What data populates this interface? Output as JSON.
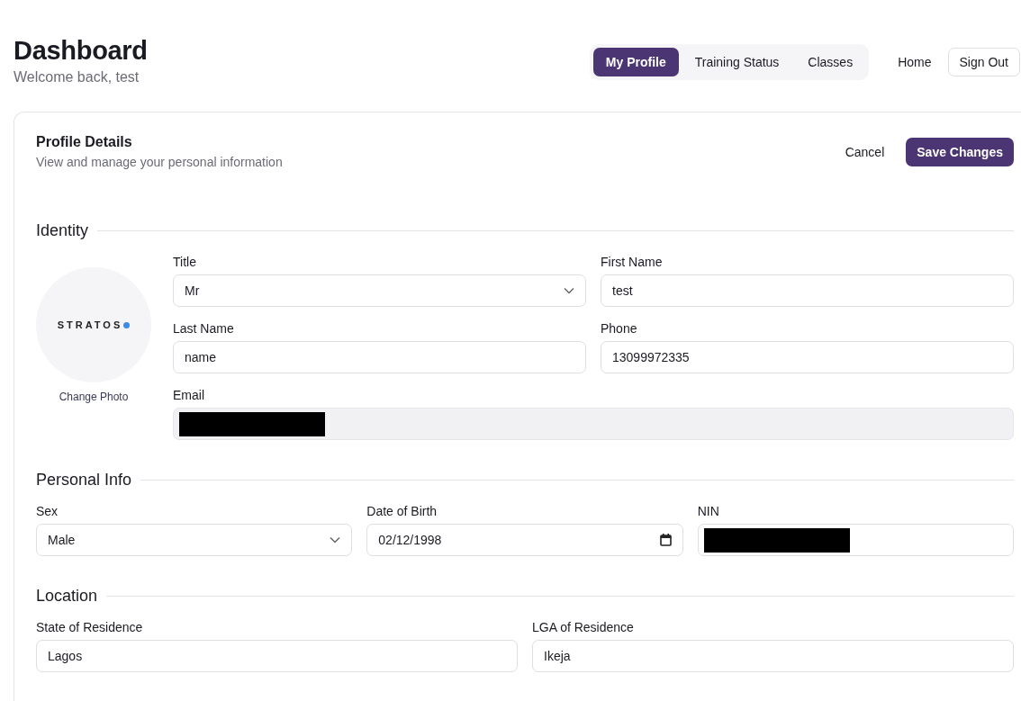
{
  "header": {
    "title": "Dashboard",
    "subtitle": "Welcome back, test"
  },
  "nav_tabs": [
    {
      "label": "My Profile",
      "selected": true
    },
    {
      "label": "Training Status",
      "selected": false
    },
    {
      "label": "Classes",
      "selected": false
    }
  ],
  "nav_links": [
    {
      "label": "Home",
      "kind": "link"
    },
    {
      "label": "Sign Out",
      "kind": "button"
    }
  ],
  "card": {
    "title": "Profile Details",
    "subtitle": "View and manage your personal information",
    "buttons": [
      {
        "label": "Cancel",
        "kind": "secondary"
      },
      {
        "label": "Save Changes",
        "kind": "primary"
      }
    ]
  },
  "sections": [
    {
      "title": "Identity",
      "avatar": {
        "logo": "STRATOS",
        "action": "Change Photo"
      },
      "fields": [
        {
          "label": "Title",
          "kind": "select",
          "value": "Mr",
          "wide": false,
          "disabled": false
        },
        {
          "label": "First Name",
          "kind": "text",
          "value": "test",
          "wide": false,
          "disabled": false
        },
        {
          "label": "Last Name",
          "kind": "text",
          "value": "name",
          "wide": false,
          "disabled": false
        },
        {
          "label": "Phone",
          "kind": "text",
          "value": "13099972335",
          "wide": false,
          "disabled": false
        },
        {
          "label": "Email",
          "kind": "text",
          "wide": true,
          "disabled": true,
          "redacted": true
        }
      ]
    },
    {
      "title": "Personal Info",
      "fields": [
        {
          "label": "Sex",
          "kind": "select",
          "value": "Male",
          "wide": false,
          "disabled": false
        },
        {
          "label": "Date of Birth",
          "kind": "date",
          "value": "02/12/1998",
          "wide": false,
          "disabled": false
        },
        {
          "label": "NIN",
          "kind": "text",
          "redacted": true,
          "wide": false,
          "disabled": false
        }
      ]
    },
    {
      "title": "Location",
      "fields": [
        {
          "label": "State of Residence",
          "kind": "text",
          "value": "Lagos",
          "wide": false,
          "disabled": false
        },
        {
          "label": "LGA of Residence",
          "kind": "text",
          "value": "Ikeja",
          "wide": false,
          "disabled": false
        }
      ]
    }
  ]
}
